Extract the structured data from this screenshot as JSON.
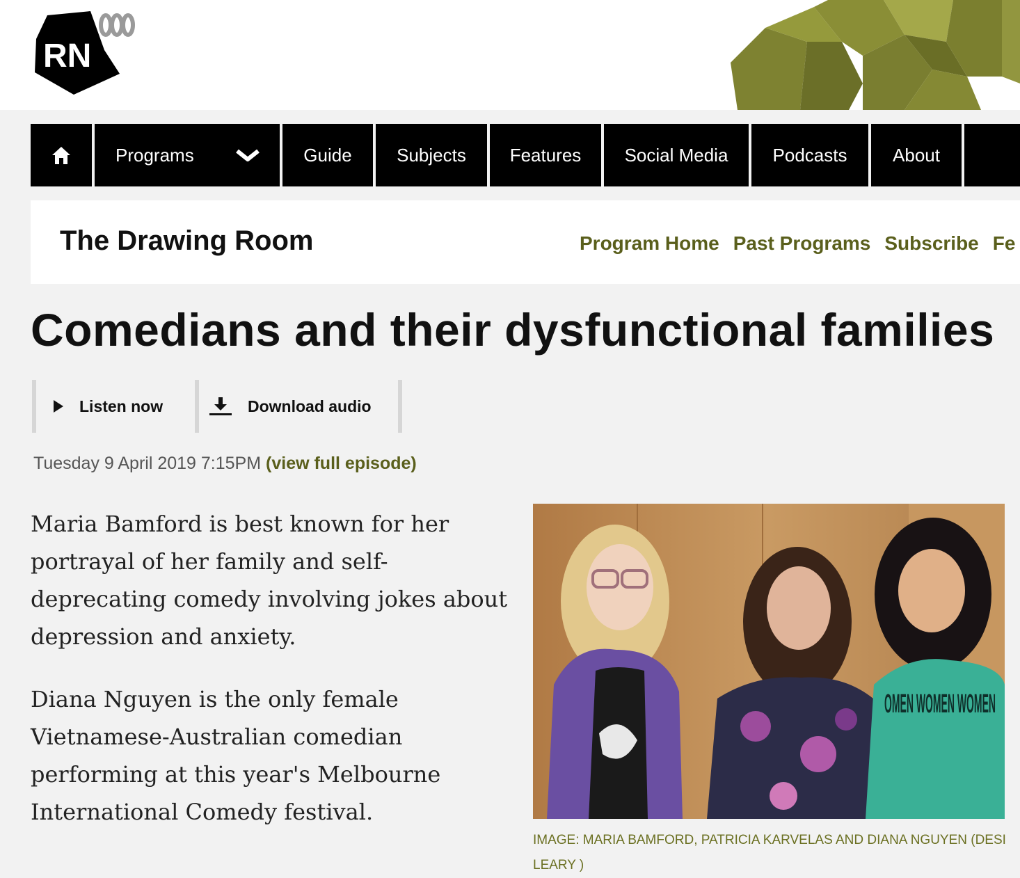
{
  "header": {
    "logo_text": "RN",
    "logo_icon": "abc-logo-icon"
  },
  "nav": {
    "home_icon": "home-icon",
    "programs": "Programs",
    "programs_icon": "chevron-down-icon",
    "guide": "Guide",
    "subjects": "Subjects",
    "features": "Features",
    "social_media": "Social Media",
    "podcasts": "Podcasts",
    "about": "About"
  },
  "program": {
    "title": "The Drawing Room",
    "links": [
      "Program Home",
      "Past Programs",
      "Subscribe",
      "Fe"
    ]
  },
  "article": {
    "headline": "Comedians and their dysfunctional families",
    "listen_label": "Listen now",
    "download_label": "Download audio",
    "date": "Tuesday 9 April 2019 7:15PM",
    "episode_link": "(view full episode)",
    "paragraphs": [
      "Maria Bamford is best known for her portrayal of her family and self-deprecating comedy involving jokes about depression and anxiety.",
      "Diana Nguyen is the only female Vietnamese-Australian comedian performing at this year's Melbourne International Comedy festival."
    ],
    "caption": "IMAGE: MARIA BAMFORD, PATRICIA KARVELAS AND DIANA NGUYEN (DESI LEARY )",
    "shirt_text": "OMEN WOMEN WOMEN"
  },
  "colors": {
    "accent_olive": "#5a5f1c",
    "caption_olive": "#6b7022",
    "nav_bg": "#000000",
    "page_bg": "#f2f2f2"
  }
}
